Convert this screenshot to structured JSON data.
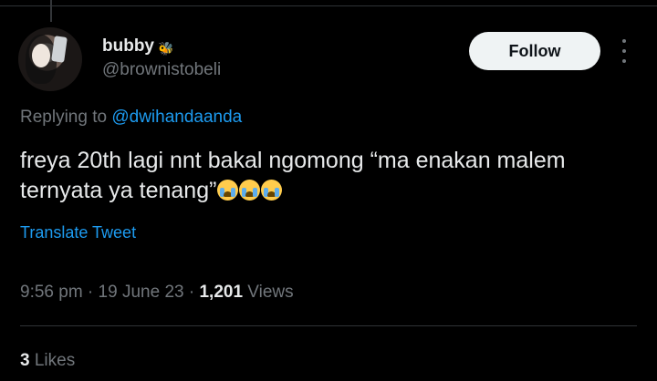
{
  "author": {
    "display_name": "bubby",
    "badge_icon": "bee-icon",
    "handle": "@brownistobeli"
  },
  "follow_label": "Follow",
  "reply": {
    "prefix": "Replying to ",
    "mention": "@dwihandaanda"
  },
  "tweet": {
    "line1": "freya 20th lagi nnt bakal ngomong “ma enakan malem",
    "line2": "ternyata ya tenang”",
    "emoji": [
      "loudly-crying-face",
      "loudly-crying-face",
      "loudly-crying-face"
    ]
  },
  "translate_label": "Translate Tweet",
  "meta": {
    "time": "9:56 pm",
    "separator": " · ",
    "date": "19 June 23",
    "views_count": "1,201",
    "views_label": " Views"
  },
  "likes": {
    "count": "3",
    "label": " Likes"
  },
  "colors": {
    "background": "#000000",
    "link": "#1d9bf0",
    "muted": "#71767b",
    "text": "#e7e9ea"
  }
}
